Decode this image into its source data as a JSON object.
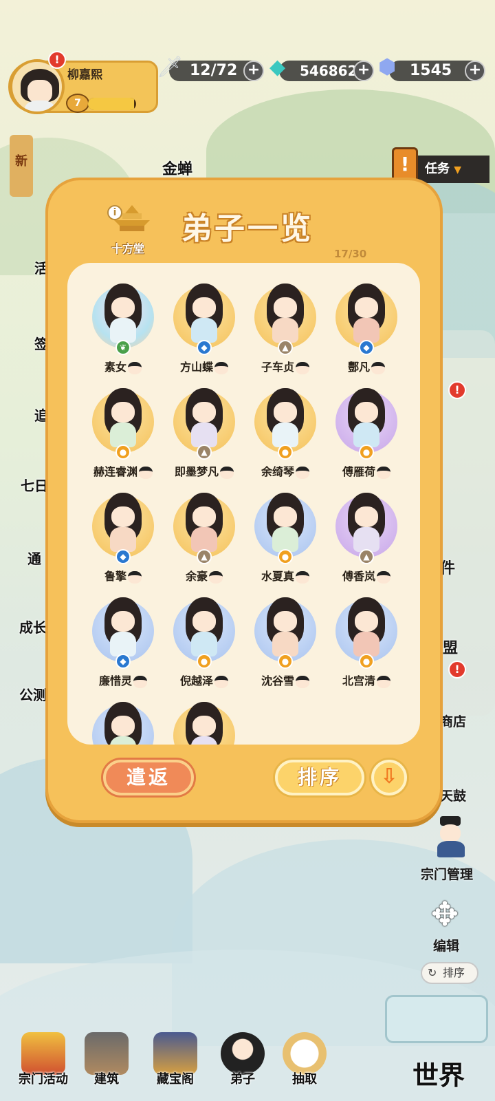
{
  "player": {
    "name": "柳嘉熙",
    "level": "7",
    "exp_fraction": 0.95
  },
  "resources": [
    {
      "icon": "sword-icon",
      "value": "12/72"
    },
    {
      "icon": "jade-icon",
      "value": "546862"
    },
    {
      "icon": "crystal-icon",
      "value": "1545"
    }
  ],
  "side_left": {
    "new_tag": "新",
    "partial_labels": [
      "金蝉",
      "活",
      "签",
      "追",
      "七日",
      "通",
      "成长",
      "公测"
    ]
  },
  "task": {
    "label": "任务"
  },
  "modal": {
    "title": "弟子一览",
    "hall_label": "十方堂",
    "count": "17/30",
    "return_label": "遣返",
    "sort_label": "排序"
  },
  "disciples": [
    {
      "name": "素女",
      "element": "wood",
      "circle": "rainbow"
    },
    {
      "name": "方山蝶",
      "element": "water",
      "circle": "gold"
    },
    {
      "name": "子车贞",
      "element": "earth",
      "circle": "gold"
    },
    {
      "name": "酆凡",
      "element": "water",
      "circle": "gold"
    },
    {
      "name": "赫连睿渊",
      "element": "fire",
      "circle": "gold"
    },
    {
      "name": "即墨梦凡",
      "element": "earth",
      "circle": "gold"
    },
    {
      "name": "余绮琴",
      "element": "fire",
      "circle": "gold"
    },
    {
      "name": "傅雁荷",
      "element": "fire",
      "circle": "purple"
    },
    {
      "name": "鲁擎",
      "element": "water",
      "circle": "gold"
    },
    {
      "name": "余豪",
      "element": "earth",
      "circle": "gold"
    },
    {
      "name": "水夏真",
      "element": "fire",
      "circle": "blue"
    },
    {
      "name": "傅香岚",
      "element": "earth",
      "circle": "purple"
    },
    {
      "name": "廉惜灵",
      "element": "water",
      "circle": "blue"
    },
    {
      "name": "倪越泽",
      "element": "fire",
      "circle": "blue"
    },
    {
      "name": "沈谷雪",
      "element": "fire",
      "circle": "blue"
    },
    {
      "name": "北宫清",
      "element": "fire",
      "circle": "blue"
    },
    {
      "name": "",
      "element": "",
      "circle": "blue"
    },
    {
      "name": "",
      "element": "",
      "circle": "gold"
    }
  ],
  "right_menu": {
    "partial_labels": [
      "件",
      "盟"
    ],
    "shop": "商店",
    "drum": "天鼓",
    "manage": "宗门管理",
    "edit": "编辑",
    "sort": "排序"
  },
  "bottom_nav": [
    {
      "label": "宗门活动",
      "icon": "pagoda-icon"
    },
    {
      "label": "建筑",
      "icon": "building-icon"
    },
    {
      "label": "藏宝阁",
      "icon": "treasure-pavilion-icon"
    },
    {
      "label": "弟子",
      "icon": "disciple-icon"
    },
    {
      "label": "抽取",
      "icon": "bird-icon"
    }
  ],
  "world": {
    "label": "世界"
  },
  "colors": {
    "frame": "#f6c15a",
    "panel": "#fbf2de",
    "return_button": "#f08a58",
    "sort_button": "#fcd36a",
    "alert": "#e23a2c"
  }
}
